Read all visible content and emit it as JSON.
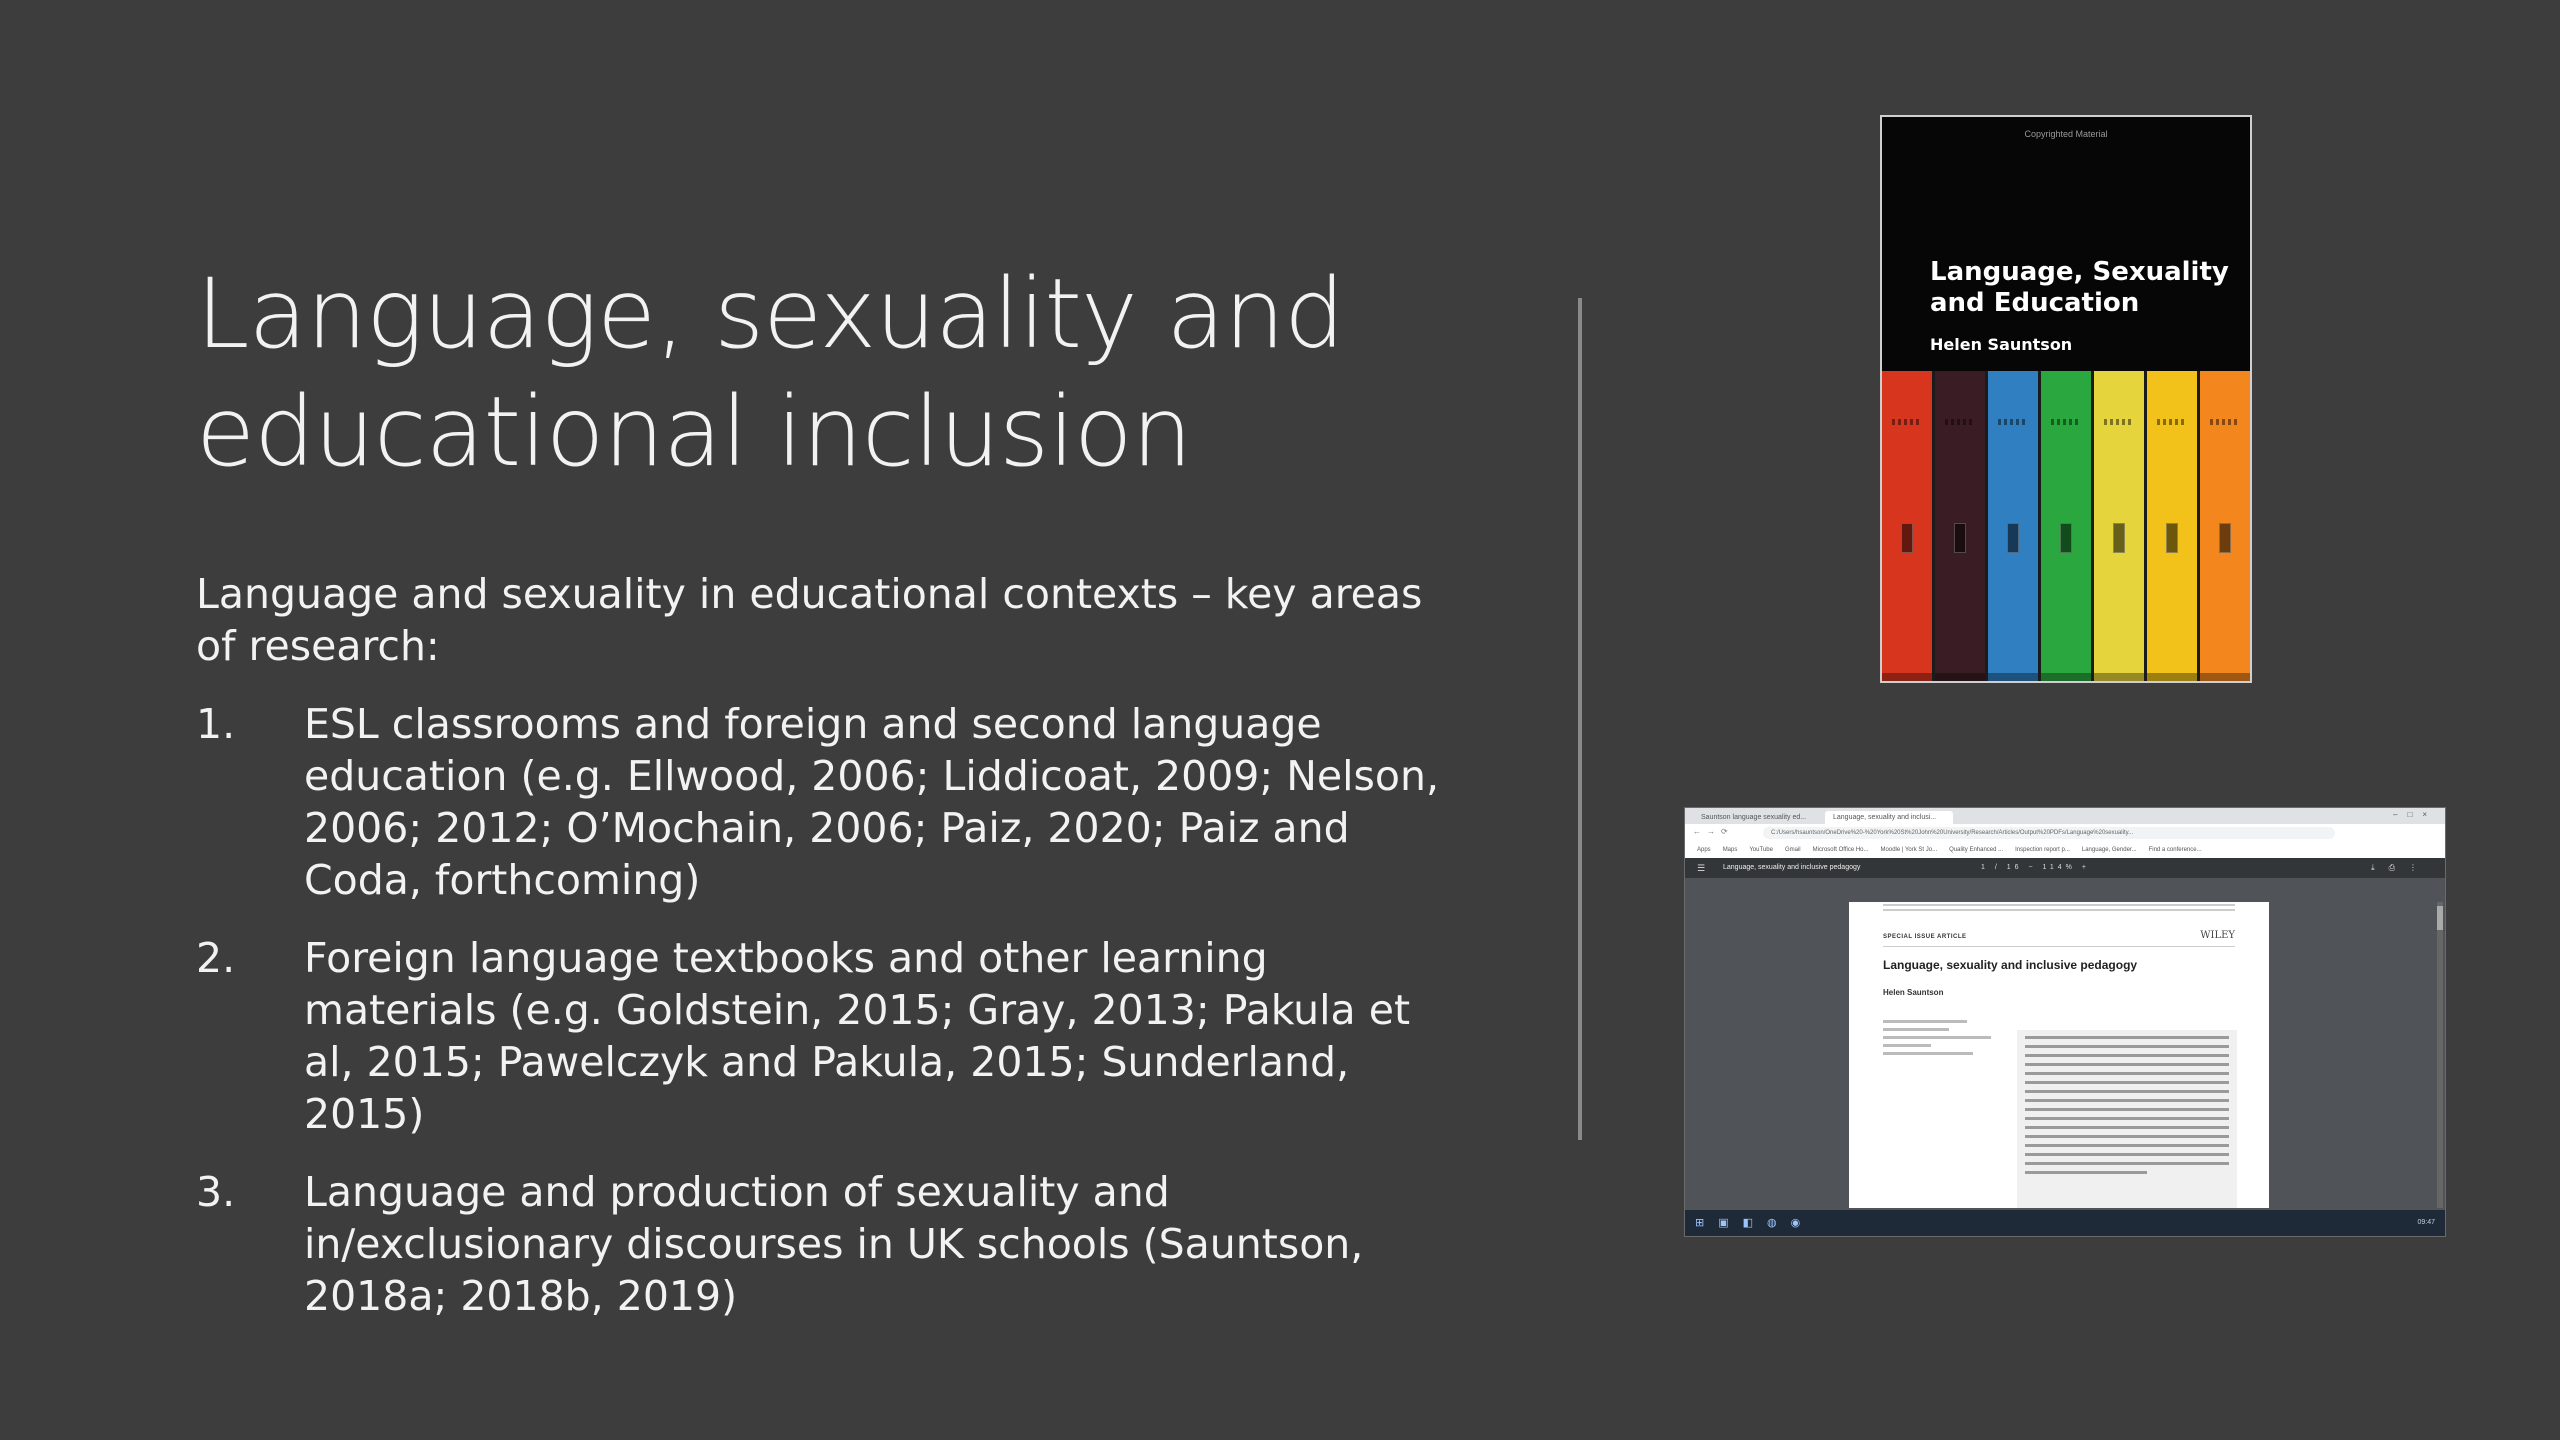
{
  "slide": {
    "title_lines": [
      "Language, sexuality and",
      "educational inclusion"
    ],
    "intro": "Language and sexuality in educational contexts – key areas of research:",
    "items": [
      {
        "num": "1.",
        "text": "ESL classrooms and foreign and second language education (e.g. Ellwood, 2006; Liddicoat, 2009; Nelson, 2006; 2012; O’Mochain, 2006; Paiz, 2020; Paiz and Coda, forthcoming)"
      },
      {
        "num": "2.",
        "text": "Foreign language textbooks and other learning materials (e.g. Goldstein, 2015; Gray, 2013; Pakula et al, 2015; Pawelczyk and Pakula, 2015; Sunderland, 2015)"
      },
      {
        "num": "3.",
        "text": "Language and production of sexuality and in/exclusionary discourses in UK schools (Sauntson, 2018a; 2018b, 2019)"
      }
    ]
  },
  "book": {
    "copyright": "Copyrighted Material",
    "title": "Language, Sexuality and Education",
    "author": "Helen Sauntson",
    "locker_colors": [
      "#d8351f",
      "#3a1d24",
      "#2f7fc1",
      "#2aa83f",
      "#e5d43b",
      "#f2c21b",
      "#f3871d"
    ]
  },
  "screenshot": {
    "tabs": [
      "Sauntson language sexuality ed...",
      "Language, sexuality and inclusi..."
    ],
    "url": "C:/Users/hsauntson/OneDrive%20-%20York%20St%20John%20University/Research/Articles/Output%20PDFs/Language%20sexuality...",
    "bookmarks": [
      "Apps",
      "Maps",
      "YouTube",
      "Gmail",
      "Microsoft Office Ho...",
      "Moodle | York St Jo...",
      "Quality Enhanced ...",
      "Inspection report p...",
      "Language, Gender...",
      "Find a conference..."
    ],
    "pdf_title": "Language, sexuality and inclusive pedagogy",
    "pdf_page": "1 / 16",
    "pdf_zoom": "114%",
    "article_label": "SPECIAL ISSUE ARTICLE",
    "publisher": "WILEY",
    "article_title": "Language, sexuality and inclusive pedagogy",
    "article_author": "Helen Sauntson",
    "taskbar_time": "09:47"
  }
}
